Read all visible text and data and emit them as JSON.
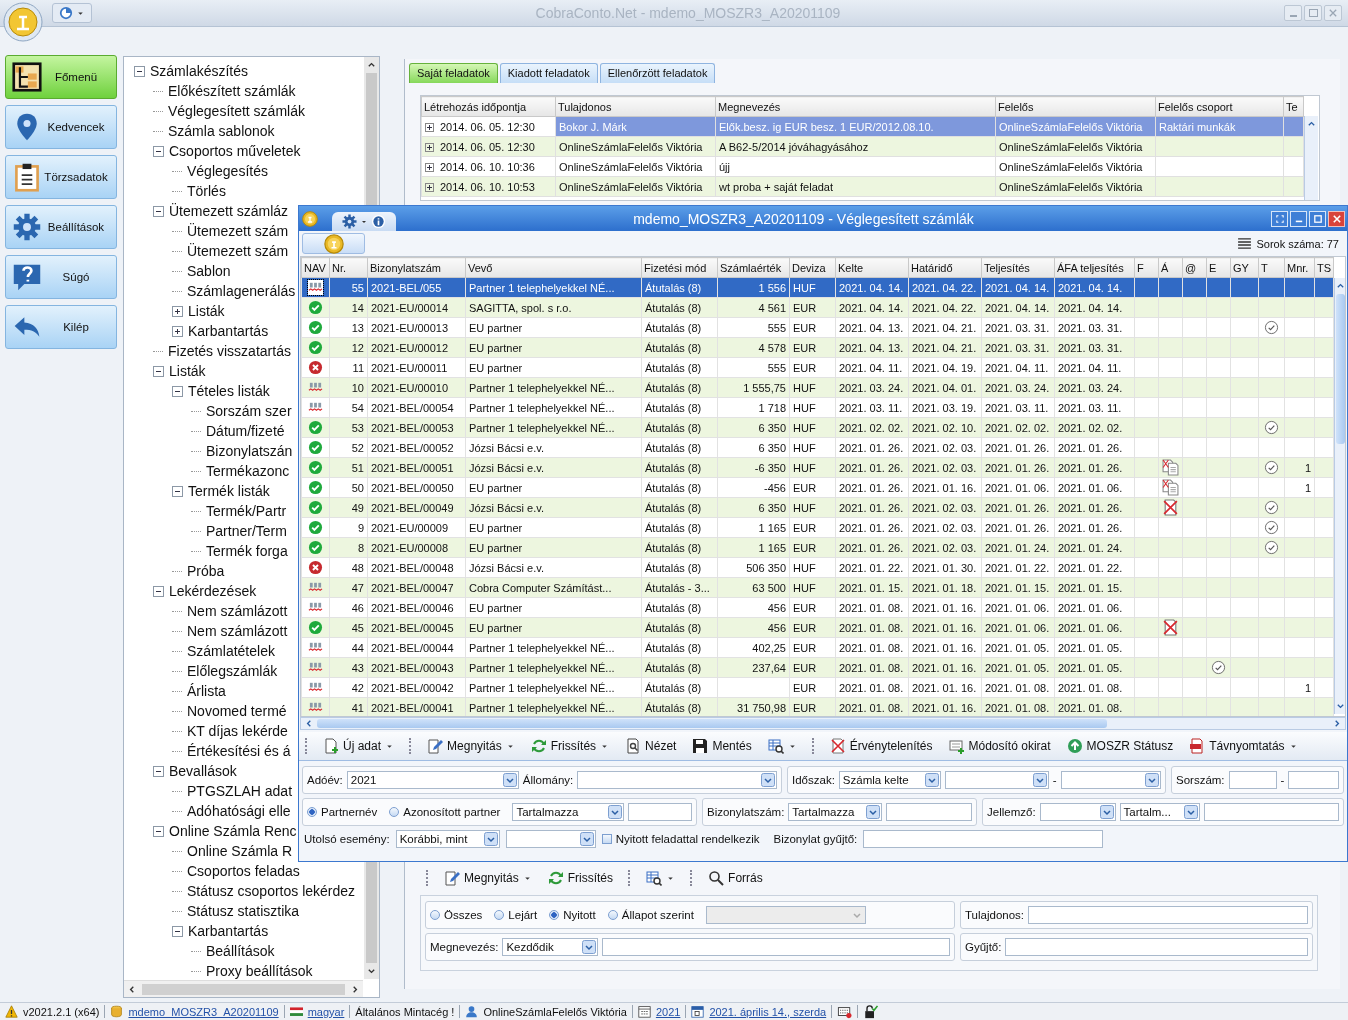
{
  "app_title": "CobraConto.Net - mdemo_MOSZR3_A20201109",
  "nav": [
    {
      "label": "Főmenü",
      "selected": true
    },
    {
      "label": "Kedvencek",
      "selected": false
    },
    {
      "label": "Törzsadatok",
      "selected": false
    },
    {
      "label": "Beállítások",
      "selected": false
    },
    {
      "label": "Súgó",
      "selected": false
    },
    {
      "label": "Kilép",
      "selected": false
    }
  ],
  "tree": [
    {
      "label": "Számlakészítés",
      "expanded": true,
      "children": [
        {
          "label": "Előkészített számlák"
        },
        {
          "label": "Véglegesített számlák"
        },
        {
          "label": "Számla sablonok"
        },
        {
          "label": "Csoportos műveletek",
          "expanded": true,
          "children": [
            {
              "label": "Véglegesítés"
            },
            {
              "label": "Törlés"
            }
          ]
        },
        {
          "label": "Ütemezett számláz",
          "expanded": true,
          "children": [
            {
              "label": "Ütemezett szám"
            },
            {
              "label": "Ütemezett szám"
            },
            {
              "label": "Sablon"
            },
            {
              "label": "Számlagenerálás"
            },
            {
              "label": "Listák",
              "expanded": false
            },
            {
              "label": "Karbantartás",
              "expanded": false
            }
          ]
        },
        {
          "label": "Fizetés visszatartás"
        },
        {
          "label": "Listák",
          "expanded": true,
          "children": [
            {
              "label": "Tételes listák",
              "expanded": true,
              "children": [
                {
                  "label": "Sorszám szer"
                },
                {
                  "label": "Dátum/fizeté"
                },
                {
                  "label": "Bizonylatszán"
                },
                {
                  "label": "Termékazonc"
                }
              ]
            },
            {
              "label": "Termék listák",
              "expanded": true,
              "children": [
                {
                  "label": "Termék/Partr"
                },
                {
                  "label": "Partner/Term"
                },
                {
                  "label": "Termék forga"
                }
              ]
            },
            {
              "label": "Próba"
            }
          ]
        },
        {
          "label": "Lekérdezések",
          "expanded": true,
          "children": [
            {
              "label": "Nem számlázott"
            },
            {
              "label": "Nem számlázott"
            },
            {
              "label": "Számlatételek"
            },
            {
              "label": "Előlegszámlák"
            },
            {
              "label": "Árlista"
            },
            {
              "label": "Novomed termé"
            },
            {
              "label": "KT díjas lekérde"
            },
            {
              "label": "Értékesítési és á"
            }
          ]
        },
        {
          "label": "Bevallások",
          "expanded": true,
          "children": [
            {
              "label": "PTGSZLAH adat"
            },
            {
              "label": "Adóhatósági elle"
            }
          ]
        },
        {
          "label": "Online Számla Renc",
          "expanded": true,
          "children": [
            {
              "label": "Online Számla R"
            },
            {
              "label": "Csoportos feladas"
            },
            {
              "label": "Státusz csoportos lekérdez"
            },
            {
              "label": "Státusz statisztika"
            },
            {
              "label": "Karbantartás",
              "expanded": true,
              "children": [
                {
                  "label": "Beállítások"
                },
                {
                  "label": "Proxy beállítások"
                }
              ]
            }
          ]
        }
      ]
    }
  ],
  "tasks": {
    "tabs": [
      {
        "label": "Saját feladatok",
        "selected": true
      },
      {
        "label": "Kiadott feladatok",
        "selected": false
      },
      {
        "label": "Ellenőrzött feladatok",
        "selected": false
      }
    ],
    "columns": [
      "Létrehozás időpontja",
      "Tulajdonos",
      "Megnevezés",
      "Felelős",
      "Felelős csoport",
      "Te"
    ],
    "rows": [
      {
        "time": "2014. 06. 05. 12:30",
        "owner": "Bokor J. Márk",
        "name": "Elők.besz. ig EUR besz. 1 EUR/2012.08.10.",
        "responsible": "OnlineSzámlaFelelős Viktória",
        "group": "Raktári munkák",
        "selected": true
      },
      {
        "time": "2014. 06. 05. 12:30",
        "owner": "OnlineSzámlaFelelős Viktória",
        "name": "A B62-5/2014 jóváhagyásához",
        "responsible": "OnlineSzámlaFelelős Viktória",
        "selected": false
      },
      {
        "time": "2014. 06. 10. 10:36",
        "owner": "OnlineSzámlaFelelős Viktória",
        "name": "újj",
        "responsible": "OnlineSzámlaFelelős Viktória",
        "selected": false
      },
      {
        "time": "2014. 06. 10. 10:53",
        "owner": "OnlineSzámlaFelelős Viktória",
        "name": "wt proba + saját feladat",
        "responsible": "OnlineSzámlaFelelős Viktória",
        "selected": false
      }
    ],
    "toolbar": [
      [
        {
          "label": "Megnyitás",
          "dropdown": true
        },
        {
          "label": "Frissítés",
          "dropdown": false
        }
      ],
      [
        {
          "dropdown": true
        }
      ],
      [
        {
          "label": "Forrás",
          "dropdown": false
        }
      ]
    ],
    "filter": {
      "states": [
        {
          "label": "Összes",
          "selected": false
        },
        {
          "label": "Lejárt",
          "selected": false
        },
        {
          "label": "Nyitott",
          "selected": true
        },
        {
          "label": "Állapot szerint",
          "selected": false
        }
      ],
      "owner_label": "Tulajdonos:",
      "name_label": "Megnevezés:",
      "name_mode": "Kezdődik",
      "collector_label": "Gyűjtő:"
    }
  },
  "window": {
    "title": "mdemo_MOSZR3_A20201109 - Véglegesített számlák",
    "row_count": "Sorok száma: 77",
    "columns": [
      "NAV",
      "Nr.",
      "Bizonylatszám",
      "Vevő",
      "Fizetési mód",
      "Számlaérték",
      "Deviza",
      "Kelte",
      "Határidő",
      "Teljesítés",
      "ÁFA teljesítés",
      "F",
      "Á",
      "@",
      "E",
      "GY",
      "T",
      "Mnr.",
      "TS"
    ],
    "rows": [
      {
        "kind": "spellcheck",
        "nr": "55",
        "number": "2021-BEL/055",
        "buyer": "Partner 1 telephelyekkel NÉ...",
        "payment": "Átutalás (8)",
        "amount": "1 556",
        "currency": "HUF",
        "issued": "2021. 04. 14.",
        "due": "2021. 04. 22.",
        "fulfilled": "2021. 04. 14.",
        "vat_date": "2021. 04. 14.",
        "e_checked": false,
        "t_checked": false,
        "selected": true
      },
      {
        "kind": "ok",
        "nr": "14",
        "number": "2021-EU/00014",
        "buyer": "SAGITTA, spol. s r.o.",
        "payment": "Átutalás (8)",
        "amount": "4 561",
        "currency": "EUR",
        "issued": "2021. 04. 14.",
        "due": "2021. 04. 22.",
        "fulfilled": "2021. 04. 14.",
        "vat_date": "2021. 04. 14.",
        "e_checked": false,
        "t_checked": false,
        "selected": false
      },
      {
        "kind": "ok",
        "nr": "13",
        "number": "2021-EU/00013",
        "buyer": "EU partner",
        "payment": "Átutalás (8)",
        "amount": "555",
        "currency": "EUR",
        "issued": "2021. 04. 13.",
        "due": "2021. 04. 21.",
        "fulfilled": "2021. 03. 31.",
        "vat_date": "2021. 03. 31.",
        "e_checked": false,
        "t_checked": true,
        "selected": false
      },
      {
        "kind": "ok",
        "nr": "12",
        "number": "2021-EU/00012",
        "buyer": "EU partner",
        "payment": "Átutalás (8)",
        "amount": "4 578",
        "currency": "EUR",
        "issued": "2021. 04. 13.",
        "due": "2021. 04. 21.",
        "fulfilled": "2021. 03. 31.",
        "vat_date": "2021. 03. 31.",
        "e_checked": false,
        "t_checked": false,
        "selected": false
      },
      {
        "kind": "error",
        "nr": "11",
        "number": "2021-EU/00011",
        "buyer": "EU partner",
        "payment": "Átutalás (8)",
        "amount": "555",
        "currency": "EUR",
        "issued": "2021. 04. 11.",
        "due": "2021. 04. 19.",
        "fulfilled": "2021. 04. 11.",
        "vat_date": "2021. 04. 11.",
        "e_checked": false,
        "t_checked": false,
        "selected": false
      },
      {
        "kind": "spellcheck",
        "nr": "10",
        "number": "2021-EU/00010",
        "buyer": "Partner 1 telephelyekkel NÉ...",
        "payment": "Átutalás (8)",
        "amount": "1 555,75",
        "currency": "HUF",
        "issued": "2021. 03. 24.",
        "due": "2021. 04. 01.",
        "fulfilled": "2021. 03. 24.",
        "vat_date": "2021. 03. 24.",
        "e_checked": false,
        "t_checked": false,
        "selected": false
      },
      {
        "kind": "spellcheck",
        "nr": "54",
        "number": "2021-BEL/00054",
        "buyer": "Partner 1 telephelyekkel NÉ...",
        "payment": "Átutalás (8)",
        "amount": "1 718",
        "currency": "HUF",
        "issued": "2021. 03. 11.",
        "due": "2021. 03. 19.",
        "fulfilled": "2021. 03. 11.",
        "vat_date": "2021. 03. 11.",
        "e_checked": false,
        "t_checked": false,
        "selected": false
      },
      {
        "kind": "ok",
        "nr": "53",
        "number": "2021-BEL/00053",
        "buyer": "Partner 1 telephelyekkel NÉ...",
        "payment": "Átutalás (8)",
        "amount": "6 350",
        "currency": "HUF",
        "issued": "2021. 02. 02.",
        "due": "2021. 02. 10.",
        "fulfilled": "2021. 02. 02.",
        "vat_date": "2021. 02. 02.",
        "e_checked": false,
        "t_checked": true,
        "selected": false
      },
      {
        "kind": "ok",
        "nr": "52",
        "number": "2021-BEL/00052",
        "buyer": "Józsi Bácsi e.v.",
        "payment": "Átutalás (8)",
        "amount": "6 350",
        "currency": "HUF",
        "issued": "2021. 01. 26.",
        "due": "2021. 02. 03.",
        "fulfilled": "2021. 01. 26.",
        "vat_date": "2021. 01. 26.",
        "e_checked": false,
        "t_checked": false,
        "selected": false
      },
      {
        "kind": "ok",
        "nr": "51",
        "number": "2021-BEL/00051",
        "buyer": "Józsi Bácsi e.v.",
        "payment": "Átutalás (8)",
        "amount": "-6 350",
        "currency": "HUF",
        "issued": "2021. 01. 26.",
        "due": "2021. 02. 03.",
        "fulfilled": "2021. 01. 26.",
        "vat_date": "2021. 01. 26.",
        "a_mark": {
          "kind": "copy"
        },
        "e_checked": false,
        "t_checked": true,
        "mnr": "1",
        "selected": false
      },
      {
        "kind": "ok",
        "nr": "50",
        "number": "2021-BEL/00050",
        "buyer": "EU partner",
        "payment": "Átutalás (8)",
        "amount": "-456",
        "currency": "EUR",
        "issued": "2021. 01. 26.",
        "due": "2021. 01. 16.",
        "fulfilled": "2021. 01. 06.",
        "vat_date": "2021. 01. 06.",
        "a_mark": {
          "kind": "copy"
        },
        "e_checked": false,
        "t_checked": false,
        "mnr": "1",
        "selected": false
      },
      {
        "kind": "ok",
        "nr": "49",
        "number": "2021-BEL/00049",
        "buyer": "Józsi Bácsi e.v.",
        "payment": "Átutalás (8)",
        "amount": "6 350",
        "currency": "HUF",
        "issued": "2021. 01. 26.",
        "due": "2021. 02. 03.",
        "fulfilled": "2021. 01. 26.",
        "vat_date": "2021. 01. 26.",
        "a_mark": {
          "kind": "cancelled"
        },
        "e_checked": false,
        "t_checked": true,
        "selected": false
      },
      {
        "kind": "ok",
        "nr": "9",
        "number": "2021-EU/00009",
        "buyer": "EU partner",
        "payment": "Átutalás (8)",
        "amount": "1 165",
        "currency": "EUR",
        "issued": "2021. 01. 26.",
        "due": "2021. 02. 03.",
        "fulfilled": "2021. 01. 26.",
        "vat_date": "2021. 01. 26.",
        "e_checked": false,
        "t_checked": true,
        "selected": false
      },
      {
        "kind": "ok",
        "nr": "8",
        "number": "2021-EU/00008",
        "buyer": "EU partner",
        "payment": "Átutalás (8)",
        "amount": "1 165",
        "currency": "EUR",
        "issued": "2021. 01. 26.",
        "due": "2021. 02. 03.",
        "fulfilled": "2021. 01. 24.",
        "vat_date": "2021. 01. 24.",
        "e_checked": false,
        "t_checked": true,
        "selected": false
      },
      {
        "kind": "error",
        "nr": "48",
        "number": "2021-BEL/00048",
        "buyer": "Józsi Bácsi e.v.",
        "payment": "Átutalás (8)",
        "amount": "506 350",
        "currency": "HUF",
        "issued": "2021. 01. 22.",
        "due": "2021. 01. 30.",
        "fulfilled": "2021. 01. 22.",
        "vat_date": "2021. 01. 22.",
        "e_checked": false,
        "t_checked": false,
        "selected": false
      },
      {
        "kind": "spellcheck",
        "nr": "47",
        "number": "2021-BEL/00047",
        "buyer": "Cobra Computer Számítást...",
        "payment": "Átutalás - 3...",
        "amount": "63 500",
        "currency": "HUF",
        "issued": "2021. 01. 15.",
        "due": "2021. 01. 18.",
        "fulfilled": "2021. 01. 15.",
        "vat_date": "2021. 01. 15.",
        "e_checked": false,
        "t_checked": false,
        "selected": false
      },
      {
        "kind": "spellcheck",
        "nr": "46",
        "number": "2021-BEL/00046",
        "buyer": "EU partner",
        "payment": "Átutalás (8)",
        "amount": "456",
        "currency": "EUR",
        "issued": "2021. 01. 08.",
        "due": "2021. 01. 16.",
        "fulfilled": "2021. 01. 06.",
        "vat_date": "2021. 01. 06.",
        "e_checked": false,
        "t_checked": false,
        "selected": false
      },
      {
        "kind": "ok",
        "nr": "45",
        "number": "2021-BEL/00045",
        "buyer": "EU partner",
        "payment": "Átutalás (8)",
        "amount": "456",
        "currency": "EUR",
        "issued": "2021. 01. 08.",
        "due": "2021. 01. 16.",
        "fulfilled": "2021. 01. 06.",
        "vat_date": "2021. 01. 06.",
        "a_mark": {
          "kind": "cancelled"
        },
        "e_checked": false,
        "t_checked": false,
        "selected": false
      },
      {
        "kind": "spellcheck",
        "nr": "44",
        "number": "2021-BEL/00044",
        "buyer": "Partner 1 telephelyekkel NÉ...",
        "payment": "Átutalás (8)",
        "amount": "402,25",
        "currency": "EUR",
        "issued": "2021. 01. 08.",
        "due": "2021. 01. 16.",
        "fulfilled": "2021. 01. 05.",
        "vat_date": "2021. 01. 05.",
        "e_checked": false,
        "t_checked": false,
        "selected": false
      },
      {
        "kind": "spellcheck",
        "nr": "43",
        "number": "2021-BEL/00043",
        "buyer": "Partner 1 telephelyekkel NÉ...",
        "payment": "Átutalás (8)",
        "amount": "237,64",
        "currency": "EUR",
        "issued": "2021. 01. 08.",
        "due": "2021. 01. 16.",
        "fulfilled": "2021. 01. 05.",
        "vat_date": "2021. 01. 05.",
        "e_checked": true,
        "t_checked": false,
        "selected": false
      },
      {
        "kind": "spellcheck",
        "nr": "42",
        "number": "2021-BEL/00042",
        "buyer": "Partner 1 telephelyekkel NÉ...",
        "payment": "Átutalás (8)",
        "currency": "EUR",
        "issued": "2021. 01. 08.",
        "due": "2021. 01. 16.",
        "fulfilled": "2021. 01. 08.",
        "vat_date": "2021. 01. 08.",
        "e_checked": false,
        "t_checked": false,
        "mnr": "1",
        "selected": false
      },
      {
        "kind": "spellcheck",
        "nr": "41",
        "number": "2021-BEL/00041",
        "buyer": "Partner 1 telephelyekkel NÉ...",
        "payment": "Átutalás (8)",
        "amount": "31 750,98",
        "currency": "EUR",
        "issued": "2021. 01. 08.",
        "due": "2021. 01. 16.",
        "fulfilled": "2021. 01. 08.",
        "vat_date": "2021. 01. 08.",
        "e_checked": false,
        "t_checked": false,
        "selected": false
      }
    ],
    "toolbar": [
      [
        {
          "label": "Új adat",
          "dropdown": true
        }
      ],
      [
        {
          "label": "Megnyitás",
          "dropdown": true
        },
        {
          "label": "Frissítés",
          "dropdown": true
        },
        {
          "label": "Nézet",
          "dropdown": false
        },
        {
          "label": "Mentés",
          "dropdown": false
        },
        {
          "dropdown": true
        }
      ],
      [
        {
          "label": "Érvénytelenítés",
          "dropdown": false
        },
        {
          "label": "Módosító okirat",
          "dropdown": false
        },
        {
          "label": "MOSZR Státusz",
          "dropdown": false
        },
        {
          "label": "Távnyomtatás",
          "dropdown": true
        }
      ]
    ],
    "filters": {
      "tax_year_label": "Adóév:",
      "tax_year": "2021",
      "file_label": "Állomány:",
      "period_label": "Időszak:",
      "period": "Számla kelte",
      "period_dash": "-",
      "serial_label": "Sorszám:",
      "serial_dash": "-",
      "partner_modes": [
        {
          "label": "Partnernév",
          "selected": true
        },
        {
          "label": "Azonosított partner",
          "selected": false
        }
      ],
      "partner_match": "Tartalmazza",
      "doc_label": "Bizonylatszám:",
      "doc_match": "Tartalmazza",
      "attr_label": "Jellemző:",
      "attr_match": "Tartalm...",
      "last_event_label": "Utolsó esemény:",
      "last_event": "Korábbi, mint",
      "open_task": {
        "label": "Nyitott feladattal rendelkezik",
        "checked": false
      },
      "collector_label": "Bizonylat gyűjtő:"
    }
  },
  "status_bar": [
    {
      "text": "v2021.2.1 (x64)",
      "kind": "plain"
    },
    {
      "text": "mdemo_MOSZR3_A20201109",
      "kind": "link"
    },
    {
      "text": "magyar",
      "kind": "link"
    },
    {
      "text": "Általános Mintacég !",
      "kind": "plain"
    },
    {
      "text": "OnlineSzámlaFelelős Viktória",
      "kind": "plain"
    },
    {
      "text": "2021",
      "kind": "link"
    },
    {
      "text": "2021. április 14., szerda",
      "kind": "link"
    }
  ]
}
